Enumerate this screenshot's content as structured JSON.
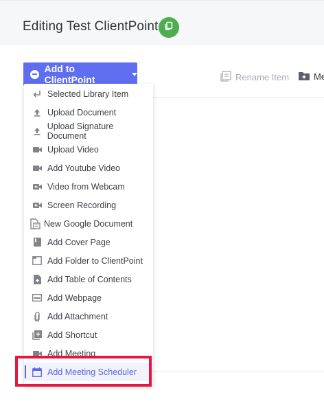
{
  "header": {
    "title": "Editing Test ClientPoint",
    "copy_icon": "copy-icon"
  },
  "add_button": {
    "label": "Add to ClientPoint"
  },
  "toolbar": {
    "rename_label": "Rename Item",
    "move_label": "Me"
  },
  "menu": {
    "items": [
      {
        "label": "Selected Library Item",
        "icon": "return-arrow-icon"
      },
      {
        "label": "Upload Document",
        "icon": "upload-icon"
      },
      {
        "label": "Upload Signature Document",
        "icon": "upload-icon"
      },
      {
        "label": "Upload Video",
        "icon": "video-camera-icon"
      },
      {
        "label": "Add Youtube Video",
        "icon": "video-camera-icon"
      },
      {
        "label": "Video from Webcam",
        "icon": "video-plus-icon"
      },
      {
        "label": "Screen Recording",
        "icon": "video-plus-icon"
      },
      {
        "label": "New Google Document",
        "icon": "google-doc-icon"
      },
      {
        "label": "Add Cover Page",
        "icon": "book-icon"
      },
      {
        "label": "Add Folder to ClientPoint",
        "icon": "folder-icon"
      },
      {
        "label": "Add Table of Contents",
        "icon": "doc-plus-icon"
      },
      {
        "label": "Add Webpage",
        "icon": "web-icon"
      },
      {
        "label": "Add Attachment",
        "icon": "paperclip-icon"
      },
      {
        "label": "Add Shortcut",
        "icon": "shortcut-icon"
      },
      {
        "label": "Add Meeting",
        "icon": "video-camera-icon"
      },
      {
        "label": "Add Meeting Scheduler",
        "icon": "calendar-icon"
      }
    ]
  },
  "colors": {
    "accent": "#5f6df0",
    "copy_button": "#4cae4f",
    "highlight": "#e5173f",
    "icon_gray": "#80848a"
  }
}
